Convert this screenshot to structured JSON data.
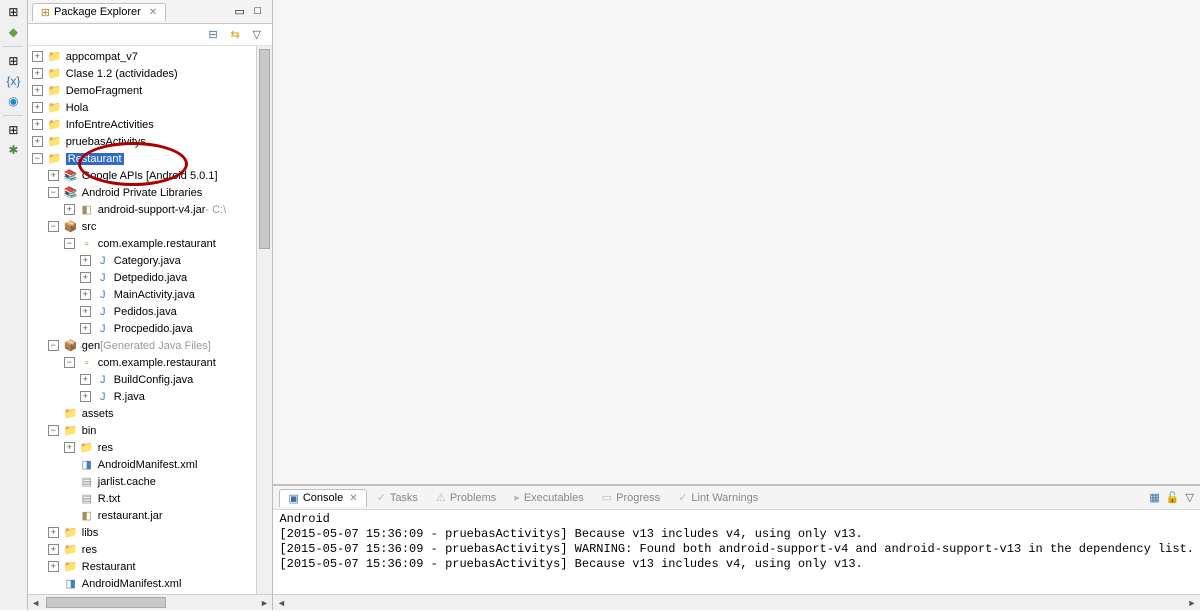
{
  "explorer": {
    "title": "Package Explorer",
    "projects": [
      {
        "label": "appcompat_v7",
        "expand": "+",
        "indent": 0,
        "icon": "proj"
      },
      {
        "label": "Clase 1.2 (actividades)",
        "expand": "+",
        "indent": 0,
        "icon": "proj"
      },
      {
        "label": "DemoFragment",
        "expand": "+",
        "indent": 0,
        "icon": "proj"
      },
      {
        "label": "Hola",
        "expand": "+",
        "indent": 0,
        "icon": "proj"
      },
      {
        "label": "InfoEntreActivities",
        "expand": "+",
        "indent": 0,
        "icon": "proj"
      },
      {
        "label": "pruebasActivitys",
        "expand": "+",
        "indent": 0,
        "icon": "proj"
      },
      {
        "label": "Restaurant",
        "expand": "-",
        "indent": 0,
        "icon": "proj",
        "selected": true
      },
      {
        "label": "Google APIs [Android 5.0.1]",
        "expand": "+",
        "indent": 1,
        "icon": "lib"
      },
      {
        "label": "Android Private Libraries",
        "expand": "-",
        "indent": 1,
        "icon": "lib"
      },
      {
        "label": "android-support-v4.jar",
        "qualifier": " - C:\\",
        "expand": "+",
        "indent": 2,
        "icon": "jar"
      },
      {
        "label": "src",
        "expand": "-",
        "indent": 1,
        "icon": "srcfolder"
      },
      {
        "label": "com.example.restaurant",
        "expand": "-",
        "indent": 2,
        "icon": "pkg"
      },
      {
        "label": "Category.java",
        "expand": "+",
        "indent": 3,
        "icon": "java"
      },
      {
        "label": "Detpedido.java",
        "expand": "+",
        "indent": 3,
        "icon": "java"
      },
      {
        "label": "MainActivity.java",
        "expand": "+",
        "indent": 3,
        "icon": "java"
      },
      {
        "label": "Pedidos.java",
        "expand": "+",
        "indent": 3,
        "icon": "java"
      },
      {
        "label": "Procpedido.java",
        "expand": "+",
        "indent": 3,
        "icon": "java"
      },
      {
        "label": "gen",
        "gen": "[Generated Java Files]",
        "expand": "-",
        "indent": 1,
        "icon": "srcfolder"
      },
      {
        "label": "com.example.restaurant",
        "expand": "-",
        "indent": 2,
        "icon": "pkg"
      },
      {
        "label": "BuildConfig.java",
        "expand": "+",
        "indent": 3,
        "icon": "java"
      },
      {
        "label": "R.java",
        "expand": "+",
        "indent": 3,
        "icon": "java"
      },
      {
        "label": "assets",
        "expand": " ",
        "indent": 1,
        "icon": "folder"
      },
      {
        "label": "bin",
        "expand": "-",
        "indent": 1,
        "icon": "folder"
      },
      {
        "label": "res",
        "expand": "+",
        "indent": 2,
        "icon": "folder"
      },
      {
        "label": "AndroidManifest.xml",
        "expand": " ",
        "indent": 2,
        "icon": "xml"
      },
      {
        "label": "jarlist.cache",
        "expand": " ",
        "indent": 2,
        "icon": "txt"
      },
      {
        "label": "R.txt",
        "expand": " ",
        "indent": 2,
        "icon": "txt"
      },
      {
        "label": "restaurant.jar",
        "expand": " ",
        "indent": 2,
        "icon": "jar"
      },
      {
        "label": "libs",
        "expand": "+",
        "indent": 1,
        "icon": "folder"
      },
      {
        "label": "res",
        "expand": "+",
        "indent": 1,
        "icon": "folder"
      },
      {
        "label": "Restaurant",
        "expand": "+",
        "indent": 1,
        "icon": "folder"
      },
      {
        "label": "AndroidManifest.xml",
        "expand": " ",
        "indent": 1,
        "icon": "xml"
      }
    ]
  },
  "bottom": {
    "tabs": [
      {
        "label": "Console",
        "active": true
      },
      {
        "label": "Tasks",
        "active": false
      },
      {
        "label": "Problems",
        "active": false
      },
      {
        "label": "Executables",
        "active": false
      },
      {
        "label": "Progress",
        "active": false
      },
      {
        "label": "Lint Warnings",
        "active": false
      }
    ],
    "context": "Android",
    "lines": [
      "[2015-05-07 15:36:09 - pruebasActivitys] Because v13 includes v4, using only v13.",
      "[2015-05-07 15:36:09 - pruebasActivitys] WARNING: Found both android-support-v4 and android-support-v13 in the dependency list.",
      "[2015-05-07 15:36:09 - pruebasActivitys] Because v13 includes v4, using only v13."
    ]
  }
}
